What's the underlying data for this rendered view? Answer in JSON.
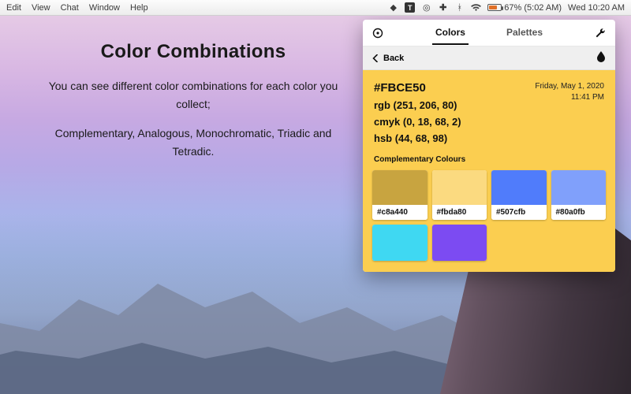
{
  "menubar": {
    "items": [
      "Edit",
      "View",
      "Chat",
      "Window",
      "Help"
    ],
    "battery_text": "67% (5:02 AM)",
    "clock": "Wed 10:20 AM",
    "sys_icons": [
      "drop-icon",
      "square-t-icon",
      "target-icon",
      "plus-icon",
      "bluetooth-icon",
      "wifi-icon"
    ]
  },
  "marketing": {
    "title": "Color Combinations",
    "line1": "You can see different color combinations for each color you collect;",
    "line2": "Complementary, Analogous, Monochromatic, Triadic and Tetradic."
  },
  "panel": {
    "tabs": {
      "colors": "Colors",
      "palettes": "Palettes",
      "active": "colors"
    },
    "back_label": "Back",
    "date": "Friday, May 1, 2020",
    "time": "11:41 PM",
    "color": {
      "hex": "#FBCE50",
      "rgb": "rgb (251, 206, 80)",
      "cmyk": "cmyk (0, 18, 68, 2)",
      "hsb": "hsb (44, 68, 98)"
    },
    "section_label": "Complementary Colours",
    "swatches": [
      {
        "hex": "#c8a440",
        "show_label": true
      },
      {
        "hex": "#fbda80",
        "show_label": true
      },
      {
        "hex": "#507cfb",
        "show_label": true
      },
      {
        "hex": "#80a0fb",
        "show_label": true
      },
      {
        "hex": "#3fd8f2",
        "show_label": false
      },
      {
        "hex": "#7c4bf2",
        "show_label": false
      }
    ]
  }
}
